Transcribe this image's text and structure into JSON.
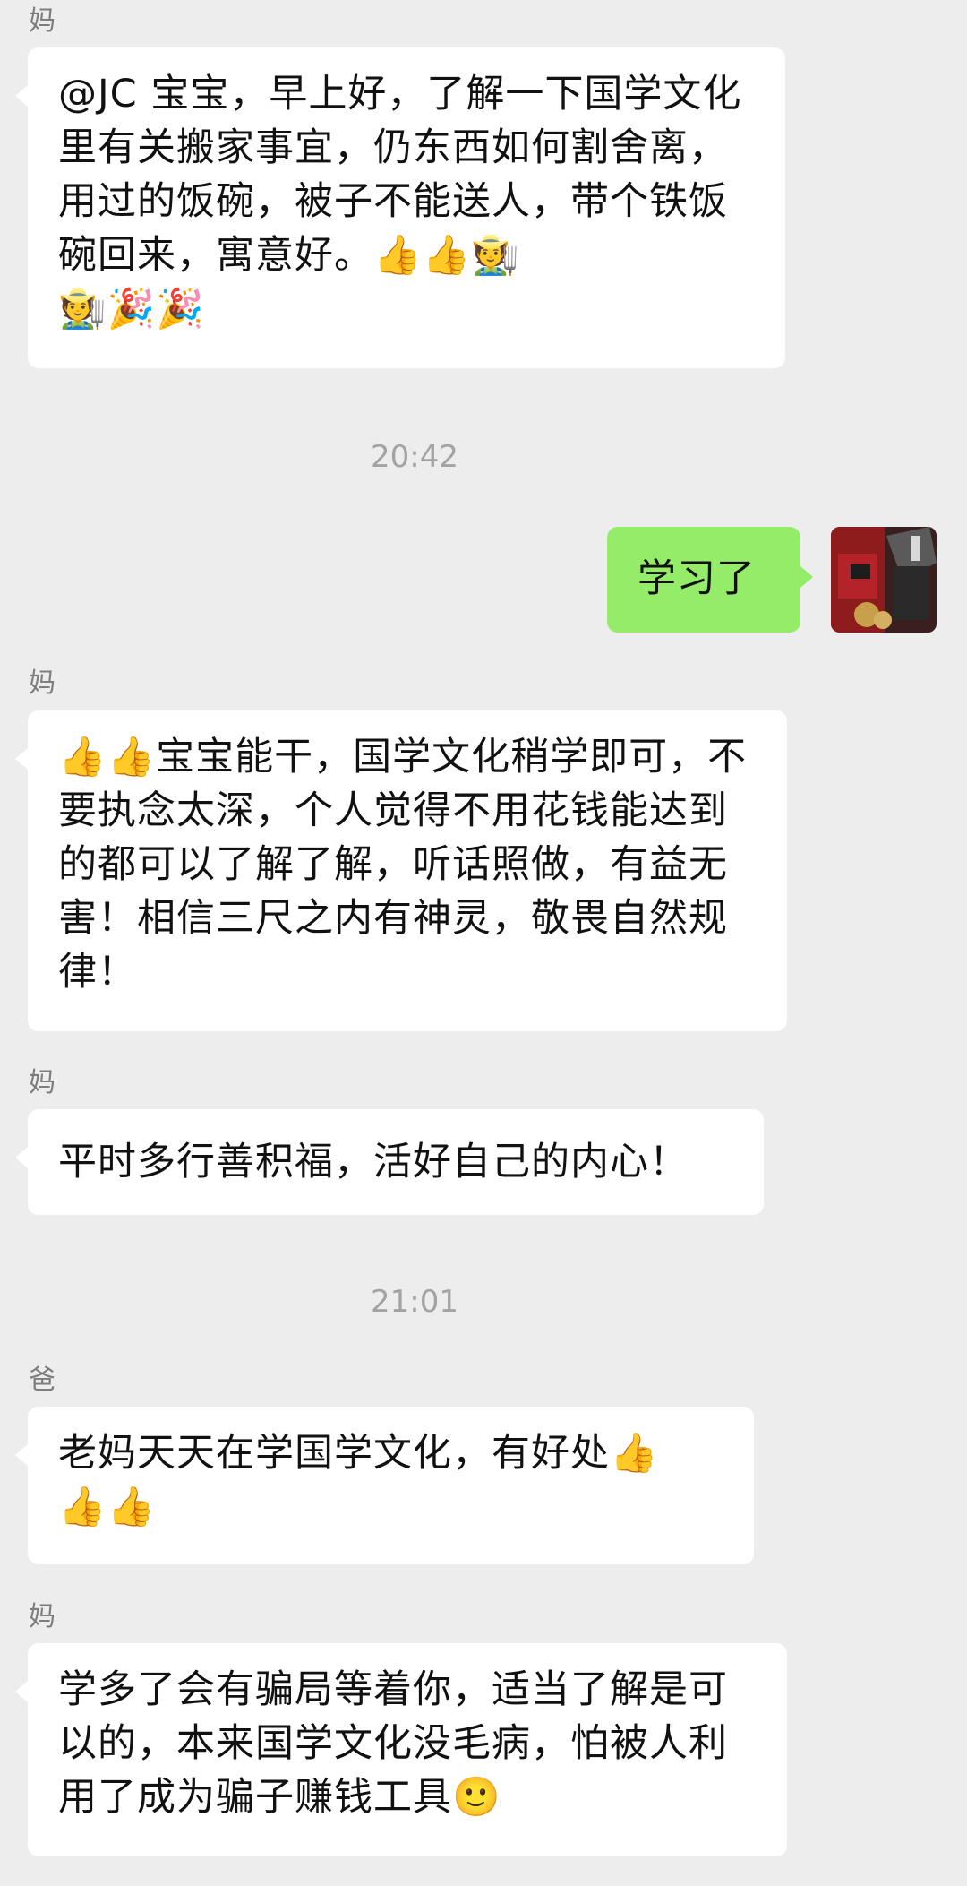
{
  "messages": [
    {
      "sender": "妈",
      "text": "@JC 宝宝，早上好，了解一下国学文化里有关搬家事宜，仍东西如何割舍离，用过的饭碗，被子不能送人，带个铁饭碗回来，寓意好。👍👍🧑‍🌾\n🧑‍🌾🎉🎉"
    },
    {
      "time": "20:42"
    },
    {
      "sender": "me",
      "text": "学习了"
    },
    {
      "sender": "妈",
      "text": "👍👍宝宝能干，国学文化稍学即可，不要执念太深，个人觉得不用花钱能达到的都可以了解了解，听话照做，有益无害！相信三尺之内有神灵，敬畏自然规律！"
    },
    {
      "sender": "妈",
      "text": "平时多行善积福，活好自己的内心！"
    },
    {
      "time": "21:01"
    },
    {
      "sender": "爸",
      "text": "老妈天天在学国学文化，有好处👍\n👍👍"
    },
    {
      "sender": "妈",
      "text": "学多了会有骗局等着你，适当了解是可以的，本来国学文化没毛病，怕被人利用了成为骗子赚钱工具🙂"
    }
  ]
}
